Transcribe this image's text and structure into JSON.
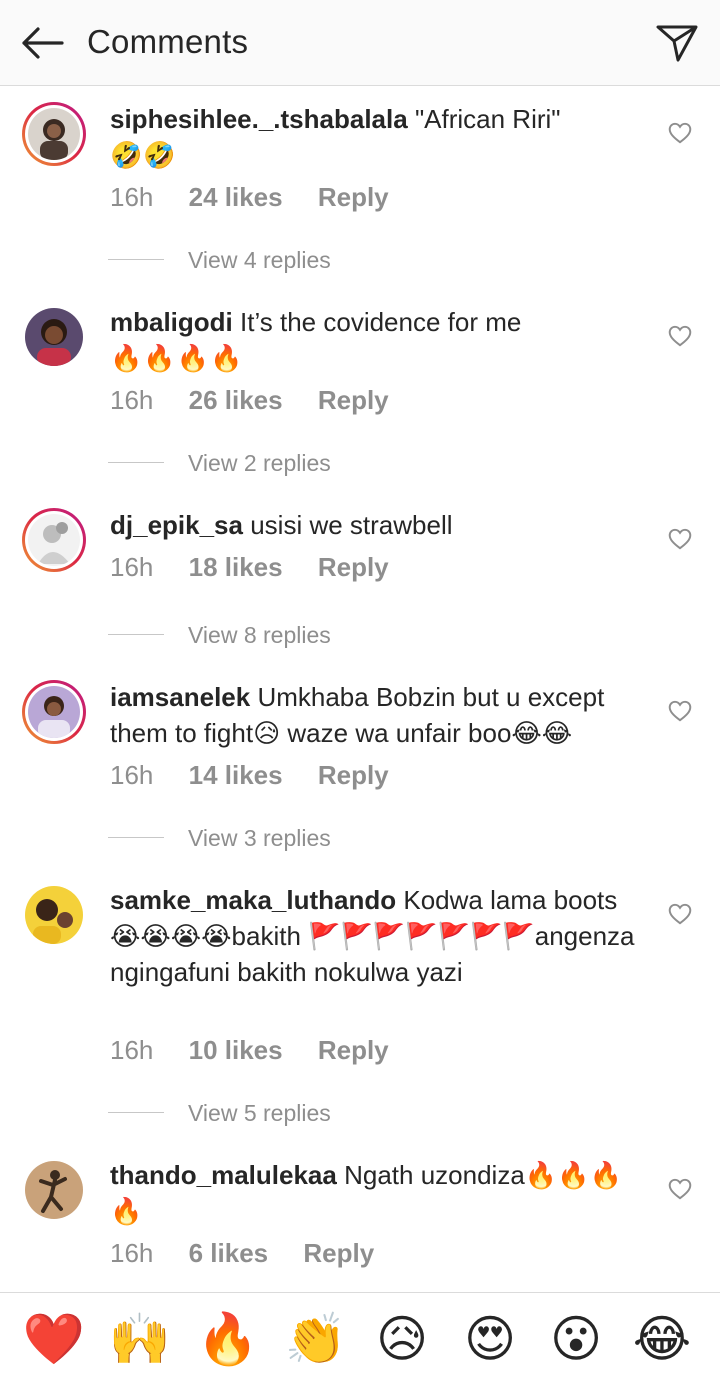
{
  "header": {
    "title": "Comments",
    "back_icon": "arrow-left-icon",
    "send_icon": "paper-plane-icon"
  },
  "comments": [
    {
      "username": "siphesihlee._.tshabalala",
      "text": "\"African Riri\"",
      "emojis": "🤣🤣",
      "time": "16h",
      "likes": "24 likes",
      "reply": "Reply",
      "view_replies": "View 4 replies"
    },
    {
      "username": "mbaligodi",
      "text": "It’s the covidence for me",
      "emojis": "🔥🔥🔥🔥",
      "time": "16h",
      "likes": "26 likes",
      "reply": "Reply",
      "view_replies": "View 2 replies"
    },
    {
      "username": "dj_epik_sa",
      "text": "usisi we strawbell",
      "emojis": "",
      "time": "16h",
      "likes": "18 likes",
      "reply": "Reply",
      "view_replies": "View 8 replies"
    },
    {
      "username": "iamsanelek",
      "text": "Umkhaba Bobzin but u except them to fight😥 waze wa unfair boo😂😂",
      "emojis": "",
      "time": "16h",
      "likes": "14 likes",
      "reply": "Reply",
      "view_replies": "View 3 replies"
    },
    {
      "username": "samke_maka_luthando",
      "text": "Kodwa lama boots😭😭😭😭bakith 🚩🚩🚩🚩🚩🚩🚩angenza ngingafuni bakith nokulwa yazi",
      "emojis": "",
      "time": "16h",
      "likes": "10 likes",
      "reply": "Reply",
      "view_replies": "View 5 replies"
    },
    {
      "username": "thando_malulekaa",
      "text": "Ngath uzondiza🔥🔥🔥🔥",
      "emojis": "",
      "time": "16h",
      "likes": "6 likes",
      "reply": "Reply",
      "view_replies": ""
    }
  ],
  "reactions": [
    "❤️",
    "🙌",
    "🔥",
    "👏",
    "😥",
    "😍",
    "😮",
    "😂"
  ],
  "colors": {
    "text": "#262626",
    "secondary": "#8e8e8e",
    "border": "#dbdbdb",
    "header_bg": "#fafafa"
  }
}
